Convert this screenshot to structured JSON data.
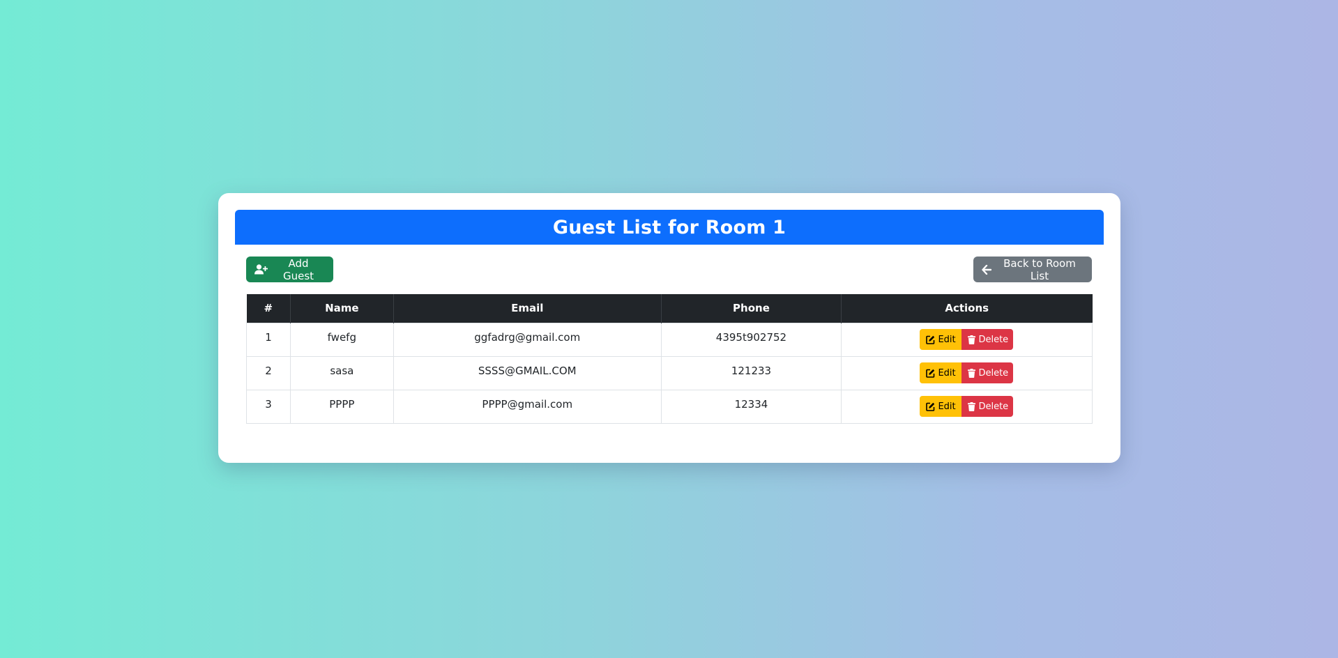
{
  "header": {
    "title": "Guest List for Room 1"
  },
  "toolbar": {
    "add_label": "Add Guest",
    "back_label": "Back to Room List"
  },
  "table": {
    "columns": [
      "#",
      "Name",
      "Email",
      "Phone",
      "Actions"
    ],
    "rows": [
      {
        "num": "1",
        "name": "fwefg",
        "email": "ggfadrg@gmail.com",
        "phone": "4395t902752"
      },
      {
        "num": "2",
        "name": "sasa",
        "email": "SSSS@GMAIL.COM",
        "phone": "121233"
      },
      {
        "num": "3",
        "name": "PPPP",
        "email": "PPPP@gmail.com",
        "phone": "12334"
      }
    ],
    "edit_label": "Edit",
    "delete_label": "Delete"
  },
  "colors": {
    "header_bg": "#0d6efd",
    "add_button": "#198754",
    "back_button": "#6c757d",
    "table_head": "#212529",
    "edit_button": "#ffc107",
    "delete_button": "#dc3545"
  },
  "icons": {
    "add": "user-plus-icon",
    "back": "arrow-left-icon",
    "edit": "edit-icon",
    "delete": "trash-icon"
  }
}
